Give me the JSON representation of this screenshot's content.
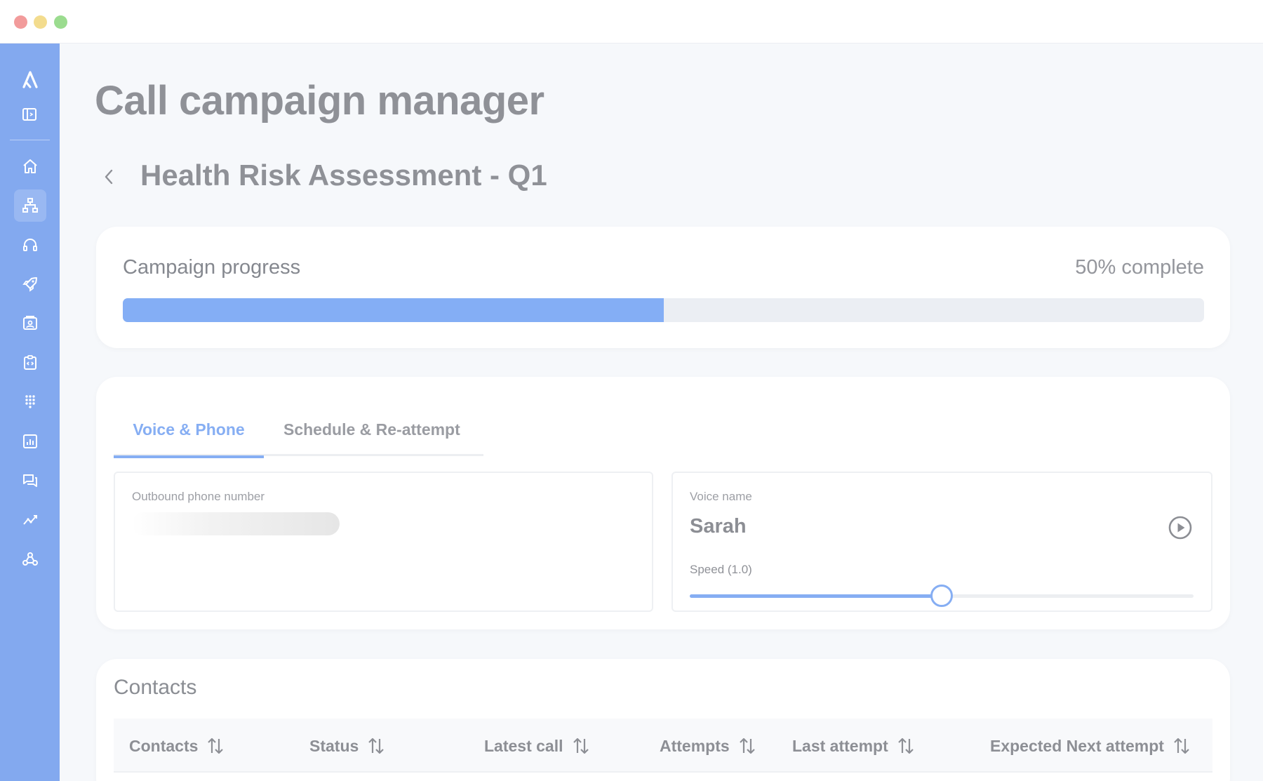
{
  "window": {
    "controls": [
      "close",
      "minimize",
      "maximize"
    ]
  },
  "sidebar": {
    "logo_icon": "logo-icon",
    "collapse_icon": "sidebar-toggle-icon",
    "items": [
      {
        "icon": "home-icon",
        "active": false
      },
      {
        "icon": "hierarchy-icon",
        "active": true
      },
      {
        "icon": "headset-icon",
        "active": false
      },
      {
        "icon": "rocket-icon",
        "active": false
      },
      {
        "icon": "contact-card-icon",
        "active": false
      },
      {
        "icon": "code-clipboard-icon",
        "active": false
      },
      {
        "icon": "dialpad-icon",
        "active": false
      },
      {
        "icon": "report-icon",
        "active": false
      },
      {
        "icon": "chat-icon",
        "active": false
      },
      {
        "icon": "analytics-icon",
        "active": false
      },
      {
        "icon": "webhook-icon",
        "active": false
      }
    ]
  },
  "page": {
    "title": "Call campaign manager",
    "campaign_name": "Health Risk Assessment - Q1"
  },
  "progress": {
    "label": "Campaign progress",
    "percent_text": "50% complete",
    "value": 50
  },
  "voice_phone": {
    "tabs": [
      {
        "label": "Voice & Phone",
        "active": true
      },
      {
        "label": "Schedule & Re-attempt",
        "active": false
      }
    ],
    "phone": {
      "label": "Outbound phone number"
    },
    "voice": {
      "label": "Voice name",
      "value": "Sarah",
      "speed_label": "Speed (1.0)",
      "speed_value": 1.0,
      "speed_min": 0.0,
      "speed_max": 2.0
    }
  },
  "contacts": {
    "title": "Contacts",
    "columns": [
      "Contacts",
      "Status",
      "Latest call",
      "Attempts",
      "Last attempt",
      "Expected Next attempt"
    ]
  },
  "colors": {
    "accent": "#86aef3",
    "sidebar": "#83a9ef",
    "background": "#f6f8fb"
  }
}
